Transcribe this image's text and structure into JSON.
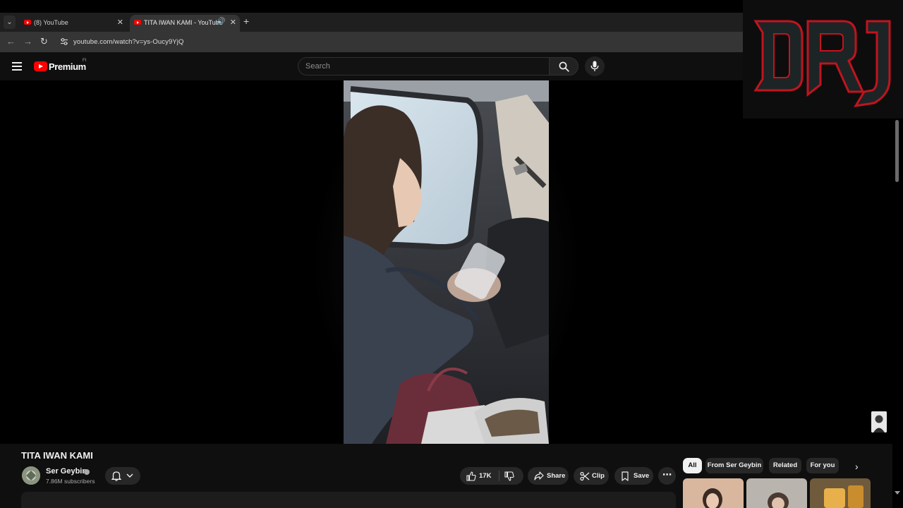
{
  "browser": {
    "tabs": [
      {
        "title": "(8) YouTube",
        "active": false
      },
      {
        "title": "TITA IWAN KAMI - YouTube",
        "active": true,
        "audio": true
      }
    ],
    "url": "youtube.com/watch?v=ys-Oucy9YjQ"
  },
  "masthead": {
    "brand": "Premium",
    "country_code": "FI",
    "search_placeholder": "Search"
  },
  "overlay_logo": {
    "text": "DRJ"
  },
  "video": {
    "title": "TITA IWAN KAMI",
    "channel": {
      "name": "Ser Geybin",
      "subscribers": "7.86M subscribers",
      "verified": true
    },
    "actions": {
      "likes": "17K",
      "share": "Share",
      "clip": "Clip",
      "save": "Save"
    }
  },
  "filter_chips": [
    {
      "label": "All",
      "active": true
    },
    {
      "label": "From Ser Geybin",
      "active": false
    },
    {
      "label": "Related",
      "active": false
    },
    {
      "label": "For you",
      "active": false
    }
  ],
  "colors": {
    "youtube_red": "#ff0000",
    "background": "#0f0f0f",
    "pill": "#272727",
    "logo_red": "#c0141e"
  }
}
